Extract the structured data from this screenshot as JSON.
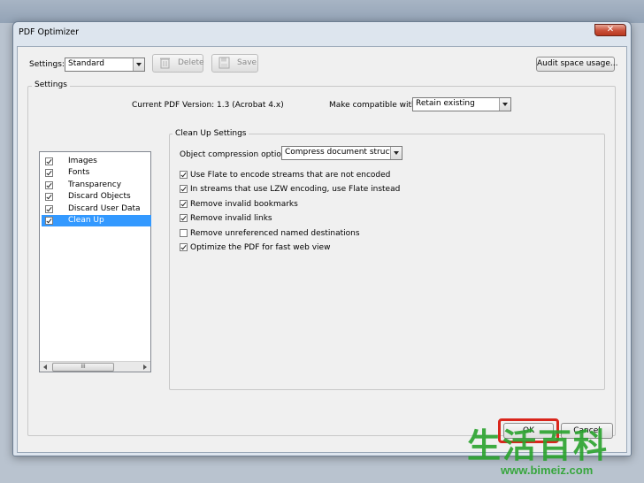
{
  "window": {
    "title": "PDF Optimizer",
    "close_glyph": "✕"
  },
  "settings": {
    "label": "Settings:",
    "value": "Standard",
    "delete_label": "Delete",
    "save_label": "Save",
    "audit_label": "Audit space usage..."
  },
  "settings_group": {
    "caption": "Settings",
    "current_version": "Current PDF Version: 1.3 (Acrobat 4.x)",
    "compat_label": "Make compatible with:",
    "compat_value": "Retain existing"
  },
  "categories": [
    {
      "label": "Images",
      "checked": true,
      "selected": false
    },
    {
      "label": "Fonts",
      "checked": true,
      "selected": false
    },
    {
      "label": "Transparency",
      "checked": true,
      "selected": false
    },
    {
      "label": "Discard Objects",
      "checked": true,
      "selected": false
    },
    {
      "label": "Discard User Data",
      "checked": true,
      "selected": false
    },
    {
      "label": "Clean Up",
      "checked": true,
      "selected": true
    }
  ],
  "scroll_thumb_glyph": "III",
  "cleanup": {
    "caption": "Clean Up Settings",
    "compression_label": "Object compression options:",
    "compression_value": "Compress document structure",
    "options": [
      {
        "label": "Use Flate to encode streams that are not encoded",
        "checked": true
      },
      {
        "label": "In streams that use LZW encoding, use Flate instead",
        "checked": true
      },
      {
        "label": "Remove invalid bookmarks",
        "checked": true
      },
      {
        "label": "Remove invalid links",
        "checked": true
      },
      {
        "label": "Remove unreferenced named destinations",
        "checked": false
      },
      {
        "label": "Optimize the PDF for fast web view",
        "checked": true
      }
    ]
  },
  "buttons": {
    "ok_label": "OK",
    "cancel_label": "Cancel"
  },
  "watermark": {
    "text": "生活百科",
    "url": "www.bimeiz.com"
  },
  "colors": {
    "selection": "#3399ff",
    "highlight": "#d9261c",
    "watermark": "#2aa32e"
  }
}
